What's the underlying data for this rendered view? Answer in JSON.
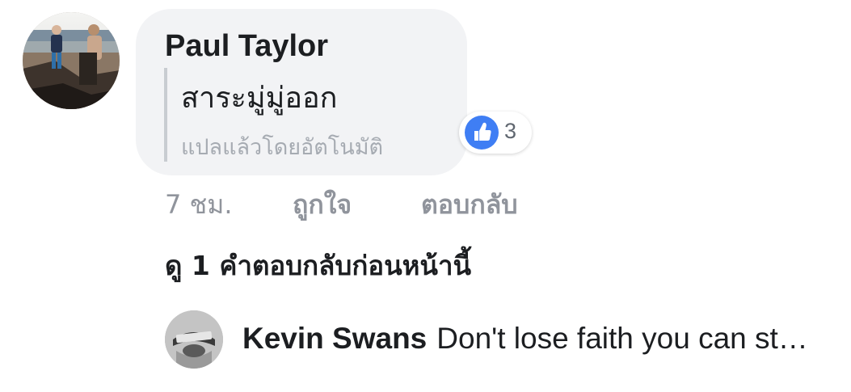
{
  "comment": {
    "author": "Paul Taylor",
    "text": "สาระมู่มู่ออก",
    "translated_note": "แปลแล้วโดยอัตโนมัติ",
    "reaction": {
      "icon": "thumbs-up-icon",
      "color": "#3f7ef4",
      "count": "3"
    },
    "actions": {
      "timestamp": "7 ชม.",
      "like_label": "ถูกใจ",
      "reply_label": "ตอบกลับ"
    }
  },
  "replies": {
    "view_previous_label": "ดู 1 คำตอบกลับก่อนหน้านี้",
    "latest": {
      "author": "Kevin Swans",
      "text": "Don't lose faith you can st…"
    }
  }
}
